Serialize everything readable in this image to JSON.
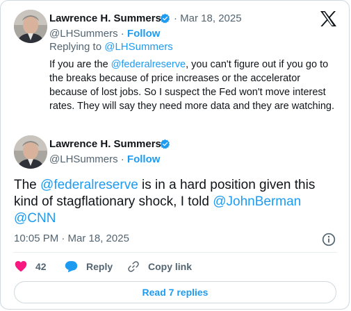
{
  "tweet_parent": {
    "author_name": "Lawrence H. Summers",
    "date": "Mar 18, 2025",
    "separator": "·",
    "handle": "@LHSummers",
    "follow_label": "Follow",
    "replying_prefix": "Replying to",
    "replying_handle": "@LHSummers",
    "text_parts": [
      "If you are the ",
      "@federalreserve",
      ", you can't figure out if you go to the breaks because of price increases or the accelerator because of lost jobs. So I suspect the Fed won't move interest rates. They will say they need more data and they are watching."
    ]
  },
  "tweet_main": {
    "author_name": "Lawrence H. Summers",
    "handle": "@LHSummers",
    "separator": "·",
    "follow_label": "Follow",
    "text_parts": [
      "The ",
      "@federalreserve",
      " is in a hard position given this kind of stagflationary shock, I told ",
      "@JohnBerman",
      " ",
      "@CNN"
    ],
    "timestamp": "10:05 PM · Mar 18, 2025"
  },
  "actions": {
    "like_count": "42",
    "reply_label": "Reply",
    "copy_link_label": "Copy link"
  },
  "read_replies_label": "Read 7 replies",
  "icons": {
    "logo": "x-logo-icon",
    "verified": "verified-badge-icon",
    "info": "info-icon",
    "like": "heart-icon",
    "reply": "reply-bubble-icon",
    "copy": "link-icon"
  },
  "colors": {
    "link": "#1d9bf0",
    "secondary_text": "#536471",
    "like": "#f91880",
    "verified": "#1d9bf0"
  }
}
